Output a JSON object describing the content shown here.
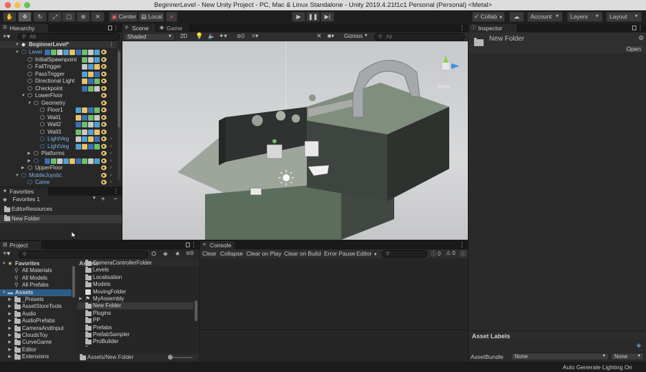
{
  "window": {
    "title": "BeginnerLevel - New Unity Project - PC, Mac & Linux Standalone - Unity 2019.4.21f1c1 Personal (Personal) <Metal>"
  },
  "toolbar": {
    "pivot_label": "Center",
    "space_label": "Local",
    "collab_label": "Collab",
    "account_label": "Account",
    "layers_label": "Layers",
    "layout_label": "Layout"
  },
  "hierarchy": {
    "tab_label": "Hierarchy",
    "search_placeholder": "All",
    "scene_name": "BeginnerLevel*",
    "items": [
      {
        "label": "Level",
        "depth": 1,
        "arrow": "down",
        "blue": true
      },
      {
        "label": "InitialSpawnpoint",
        "depth": 2
      },
      {
        "label": "FallTrigger",
        "depth": 2
      },
      {
        "label": "PassTrigger",
        "depth": 2
      },
      {
        "label": "Directional Light",
        "depth": 2
      },
      {
        "label": "Checkpoint",
        "depth": 2
      },
      {
        "label": "LowerFloor",
        "depth": 2,
        "arrow": "down"
      },
      {
        "label": "Geometry",
        "depth": 3,
        "arrow": "down"
      },
      {
        "label": "Floor1",
        "depth": 4
      },
      {
        "label": "Wall1",
        "depth": 4
      },
      {
        "label": "Wall2",
        "depth": 4
      },
      {
        "label": "Wall3",
        "depth": 4
      },
      {
        "label": "LightVeg",
        "depth": 4,
        "blue": true
      },
      {
        "label": "LightVeg",
        "depth": 4,
        "blue": true
      },
      {
        "label": "Platforms",
        "depth": 3,
        "arrow": "right"
      },
      {
        "label": "",
        "depth": 3,
        "arrow": "right",
        "blue": true
      },
      {
        "label": "UpperFloor",
        "depth": 2,
        "arrow": "right"
      },
      {
        "label": "MobileJoystic",
        "depth": 1,
        "arrow": "down",
        "blue": true
      },
      {
        "label": "Came",
        "depth": 2,
        "blue": true
      }
    ]
  },
  "favorites_panel": {
    "tab_label": "Favorites",
    "dropdown_label": "Favorites 1",
    "items": [
      "EditorResources",
      "New Folder"
    ]
  },
  "scene": {
    "tab_scene": "Scene",
    "tab_game": "Game",
    "shading_mode": "Shaded",
    "mode_2d": "2D",
    "hidden_count": "0",
    "gizmos_label": "Gizmos",
    "search_placeholder": "All",
    "view_label": "Persp"
  },
  "inspector": {
    "tab_label": "Inspector",
    "object_name": "New Folder",
    "open_button": "Open",
    "asset_labels_title": "Asset Labels",
    "asset_bundle_label": "AssetBundle",
    "asset_bundle_value": "None",
    "asset_bundle_variant": "None"
  },
  "project": {
    "tab_label": "Project",
    "hidden_count": "8",
    "left": {
      "favorites_header": "Favorites",
      "favorites": [
        "All Materials",
        "All Models",
        "All Prefabs"
      ],
      "assets_header": "Assets",
      "assets": [
        "_Presets",
        "AssetStoreTools",
        "Audio",
        "AudioPrefabs",
        "CameraAndInput",
        "CloudsToy",
        "CurveGame",
        "Editor",
        "Extensions"
      ]
    },
    "right": {
      "header": "Assets",
      "items": [
        "CameraControllerFolder",
        "Levels",
        "Localisation",
        "Models",
        "MovingFolder",
        "MyAssembly",
        "New Folder",
        "Plugins",
        "PP",
        "Prefabs",
        "PrefabSampler",
        "ProBuilder",
        "ProBuilder Data"
      ]
    },
    "breadcrumb": "Assets/New Folder"
  },
  "console": {
    "tab_label": "Console",
    "buttons": [
      "Clear",
      "Collapse",
      "Clear on Play",
      "Clear on Build",
      "Error Pause",
      "Editor"
    ],
    "error_count": "0",
    "warning_count": "0"
  },
  "status_bar": {
    "text": "Auto Generate Lighting On"
  }
}
